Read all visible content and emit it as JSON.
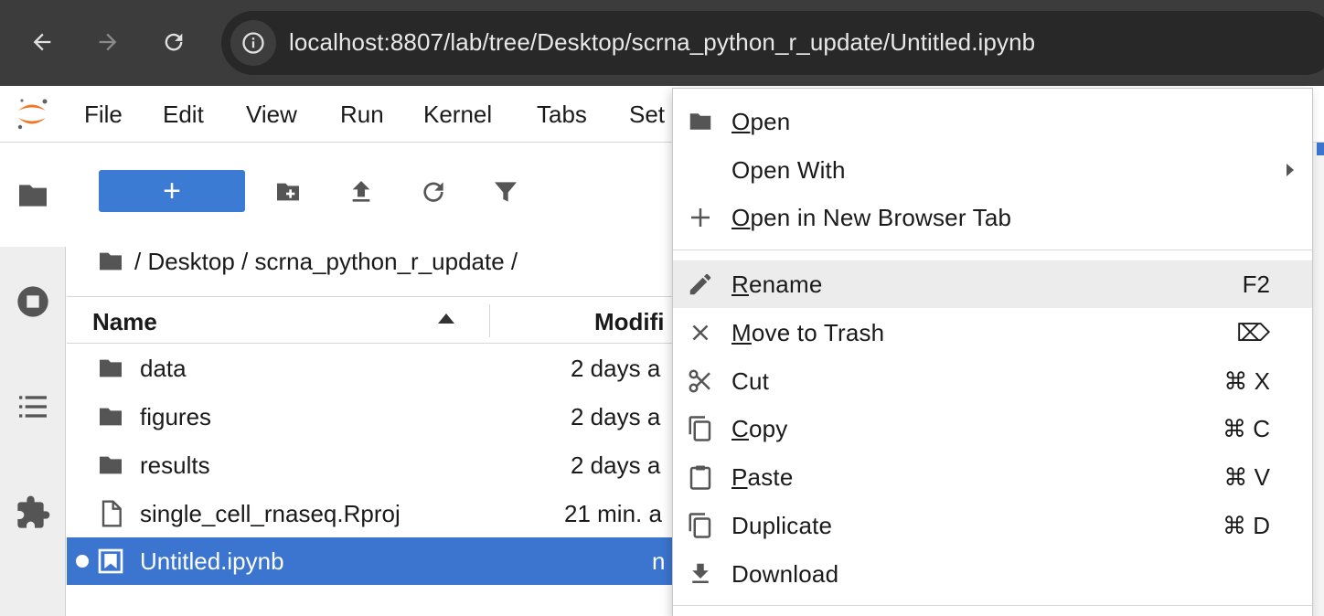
{
  "browser": {
    "url": "localhost:8807/lab/tree/Desktop/scrna_python_r_update/Untitled.ipynb"
  },
  "menubar": {
    "items": [
      "File",
      "Edit",
      "View",
      "Run",
      "Kernel",
      "Tabs",
      "Set"
    ]
  },
  "filebrowser": {
    "new_label": "+",
    "breadcrumb": "/ Desktop / scrna_python_r_update /",
    "header": {
      "name": "Name",
      "modified": "Modifi"
    },
    "files": [
      {
        "name": "data",
        "modified": "2 days a",
        "type": "folder"
      },
      {
        "name": "figures",
        "modified": "2 days a",
        "type": "folder"
      },
      {
        "name": "results",
        "modified": "2 days a",
        "type": "folder"
      },
      {
        "name": "single_cell_rnaseq.Rproj",
        "modified": "21 min. a",
        "type": "file"
      },
      {
        "name": "Untitled.ipynb",
        "modified": "n",
        "type": "notebook",
        "selected": true
      }
    ]
  },
  "context_menu": {
    "items": [
      {
        "label": "Open",
        "icon": "folder-icon",
        "shortcut": ""
      },
      {
        "label": "Open With",
        "icon": "",
        "shortcut": "",
        "submenu": true
      },
      {
        "label": "Open in New Browser Tab",
        "icon": "plus-icon",
        "shortcut": ""
      },
      {
        "label": "Rename",
        "icon": "pencil-icon",
        "shortcut": "F2",
        "active": true
      },
      {
        "label": "Move to Trash",
        "icon": "close-icon",
        "shortcut": "⌦"
      },
      {
        "label": "Cut",
        "icon": "scissors-icon",
        "shortcut": "⌘ X"
      },
      {
        "label": "Copy",
        "icon": "copy-icon",
        "shortcut": "⌘ C"
      },
      {
        "label": "Paste",
        "icon": "clipboard-icon",
        "shortcut": "⌘ V"
      },
      {
        "label": "Duplicate",
        "icon": "duplicate-icon",
        "shortcut": "⌘ D"
      },
      {
        "label": "Download",
        "icon": "download-icon",
        "shortcut": ""
      }
    ]
  },
  "colors": {
    "accent": "#3b75cf",
    "browser_bg": "#3c3c3c",
    "url_bg": "#282828"
  }
}
